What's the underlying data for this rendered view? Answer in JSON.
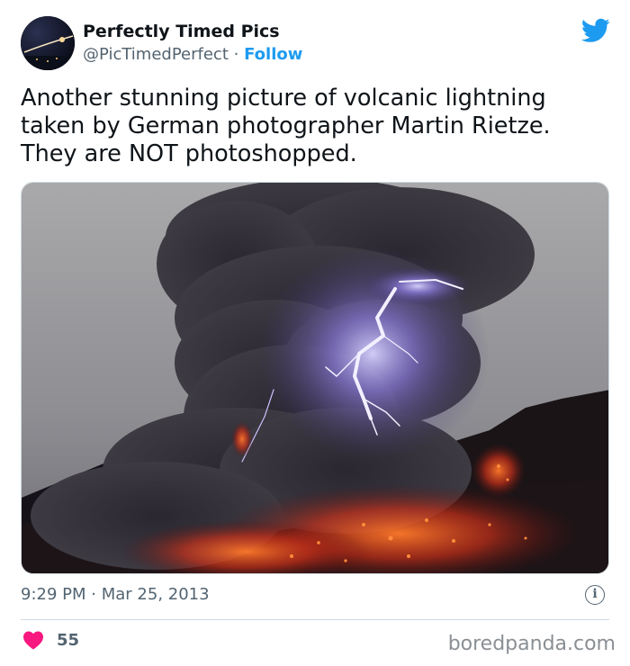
{
  "author": {
    "display_name": "Perfectly Timed Pics",
    "handle": "@PicTimedPerfect",
    "separator": "·",
    "follow_label": "Follow"
  },
  "tweet": {
    "text": "Another stunning picture of volcanic lightning taken by German photographer Martin Rietze. They are NOT photoshopped.",
    "time": "9:29 PM",
    "date_separator": "·",
    "date": "Mar 25, 2013"
  },
  "engagement": {
    "like_icon": "heart-icon",
    "like_count": "55"
  },
  "watermark": "boredpanda.com",
  "icons": {
    "platform": "twitter-bird-icon",
    "info": "info-icon"
  },
  "colors": {
    "accent": "#1d9bf0",
    "like": "#f91880",
    "muted": "#536471"
  }
}
